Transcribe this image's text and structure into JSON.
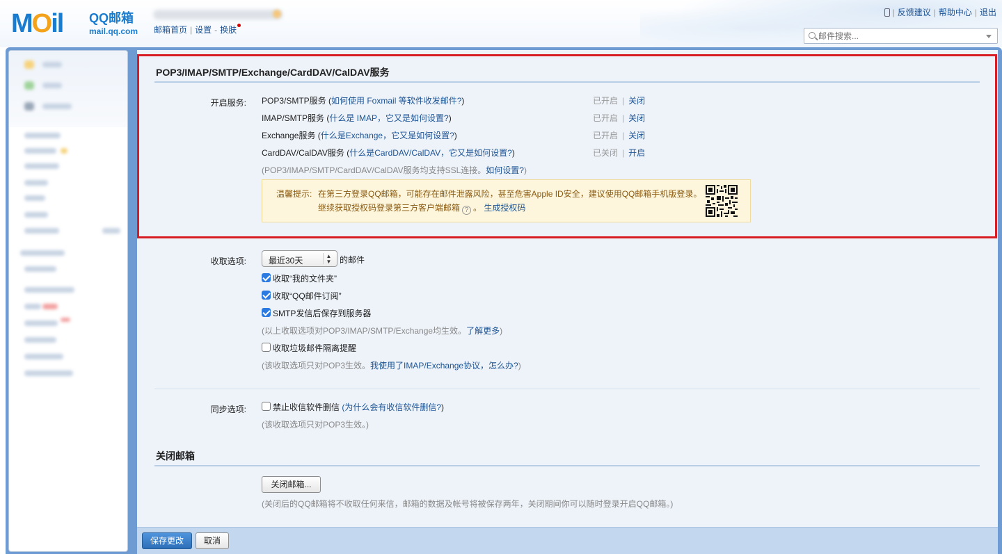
{
  "header": {
    "logo_text": "MOil",
    "brand": "QQ邮箱",
    "domain": "mail.qq.com",
    "nav": {
      "home": "邮箱首页",
      "sep1": "|",
      "settings": "设置",
      "sep2": "-",
      "skin": "换肤"
    },
    "top_links": {
      "feedback": "反馈建议",
      "help": "帮助中心",
      "logout": "退出",
      "sep": "|"
    },
    "search_placeholder": "邮件搜索..."
  },
  "pop_section": {
    "title": "POP3/IMAP/SMTP/Exchange/CardDAV/CalDAV服务",
    "label": "开启服务:",
    "services": [
      {
        "name": "POP3/SMTP服务 (",
        "link": "如何使用 Foxmail 等软件收发邮件?",
        "close_paren": ")",
        "status": "已开启",
        "action": "关闭"
      },
      {
        "name": "IMAP/SMTP服务 (",
        "link": "什么是 IMAP，它又是如何设置?",
        "close_paren": ")",
        "status": "已开启",
        "action": "关闭"
      },
      {
        "name": "Exchange服务 (",
        "link": "什么是Exchange，它又是如何设置?",
        "close_paren": ")",
        "status": "已开启",
        "action": "关闭"
      },
      {
        "name": "CardDAV/CalDAV服务 (",
        "link": "什么是CardDAV/CalDAV，它又是如何设置?",
        "close_paren": ")",
        "status": "已关闭",
        "action": "开启"
      }
    ],
    "ssl_note": "(POP3/IMAP/SMTP/CardDAV/CalDAV服务均支持SSL连接。",
    "ssl_link": "如何设置?",
    "ssl_close": ")",
    "tip": {
      "title": "温馨提示:",
      "line1": "在第三方登录QQ邮箱，可能存在邮件泄露风险，甚至危害Apple ID安全，建议使用QQ邮箱手机版登录。",
      "line2": "继续获取授权码登录第三方客户端邮箱",
      "help_glyph": "?",
      "line2_end": "。",
      "link": "生成授权码"
    }
  },
  "receive": {
    "label": "收取选项:",
    "select_value": "最近30天",
    "select_suffix": "的邮件",
    "options": [
      {
        "text": "收取“我的文件夹”",
        "checked": true
      },
      {
        "text": "收取“QQ邮件订阅”",
        "checked": true
      },
      {
        "text": "SMTP发信后保存到服务器",
        "checked": true
      }
    ],
    "note1": "(以上收取选项对POP3/IMAP/SMTP/Exchange均生效。",
    "note1_link": "了解更多",
    "note1_close": ")",
    "spam_option": {
      "text": "收取垃圾邮件隔离提醒",
      "checked": false
    },
    "note2": "(该收取选项只对POP3生效。",
    "note2_link": "我使用了IMAP/Exchange协议，怎么办?",
    "note2_close": ")"
  },
  "sync": {
    "label": "同步选项:",
    "option": {
      "text": "禁止收信软件删信",
      "checked": false
    },
    "option_link": "(为什么会有收信软件删信?",
    "option_close": ")",
    "note": "(该收取选项只对POP3生效。)"
  },
  "close_mailbox": {
    "title": "关闭邮箱",
    "button": "关闭邮箱...",
    "note": "(关闭后的QQ邮箱将不收取任何来信，邮箱的数据及帐号将被保存两年，关闭期间你可以随时登录开启QQ邮箱。)"
  },
  "footer": {
    "save": "保存更改",
    "cancel": "取消"
  },
  "colors": {
    "accent": "#1a7ccf",
    "link": "#1e5494",
    "highlight": "#d71c23",
    "frame": "#6e9bd2"
  }
}
